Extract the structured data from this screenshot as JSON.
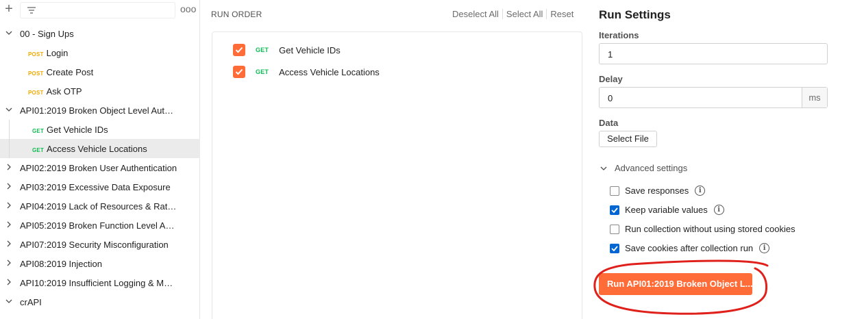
{
  "sidebar": {
    "plus_icon": "plus-icon",
    "filter_icon": "filter-icon",
    "more_icon": "more-horizontal-icon",
    "more_label": "ooo",
    "plus_label": "+",
    "folders": [
      {
        "label": "00 - Sign Ups",
        "expanded": true,
        "requests": [
          {
            "method": "POST",
            "label": "Login"
          },
          {
            "method": "POST",
            "label": "Create Post"
          },
          {
            "method": "POST",
            "label": "Ask OTP"
          }
        ]
      },
      {
        "label": "API01:2019 Broken Object Level Autho...",
        "expanded": true,
        "requests": [
          {
            "method": "GET",
            "label": "Get Vehicle IDs"
          },
          {
            "method": "GET",
            "label": "Access Vehicle Locations",
            "selected": true
          }
        ]
      },
      {
        "label": "API02:2019 Broken User Authentication",
        "expanded": false
      },
      {
        "label": "API03:2019 Excessive Data Exposure",
        "expanded": false
      },
      {
        "label": "API04:2019 Lack of Resources & Rate ...",
        "expanded": false
      },
      {
        "label": "API05:2019 Broken Function Level Aut...",
        "expanded": false
      },
      {
        "label": "API07:2019 Security Misconfiguration",
        "expanded": false
      },
      {
        "label": "API08:2019 Injection",
        "expanded": false
      },
      {
        "label": "API10:2019 Insufficient Logging & Mon...",
        "expanded": false
      },
      {
        "label": "crAPI",
        "expanded": true
      }
    ]
  },
  "run_order": {
    "title": "RUN ORDER",
    "deselect_all": "Deselect All",
    "select_all": "Select All",
    "reset": "Reset",
    "items": [
      {
        "method": "GET",
        "label": "Get Vehicle IDs",
        "checked": true
      },
      {
        "method": "GET",
        "label": "Access Vehicle Locations",
        "checked": true
      }
    ]
  },
  "run_settings": {
    "title": "Run Settings",
    "iterations_label": "Iterations",
    "iterations_value": "1",
    "delay_label": "Delay",
    "delay_value": "0",
    "delay_unit": "ms",
    "data_label": "Data",
    "select_file": "Select File",
    "advanced_label": "Advanced settings",
    "options": [
      {
        "label": "Save responses",
        "checked": false,
        "info": true
      },
      {
        "label": "Keep variable values",
        "checked": true,
        "info": true
      },
      {
        "label": "Run collection without using stored cookies",
        "checked": false,
        "info": false
      },
      {
        "label": "Save cookies after collection run",
        "checked": true,
        "info": true
      }
    ],
    "run_button": "Run API01:2019 Broken Object L...",
    "info_glyph": "i"
  },
  "colors": {
    "accent": "#ff6c37",
    "get": "#0cbb52",
    "post": "#f2a900",
    "checkbox": "#0265d2",
    "annotation": "#e0201b"
  }
}
